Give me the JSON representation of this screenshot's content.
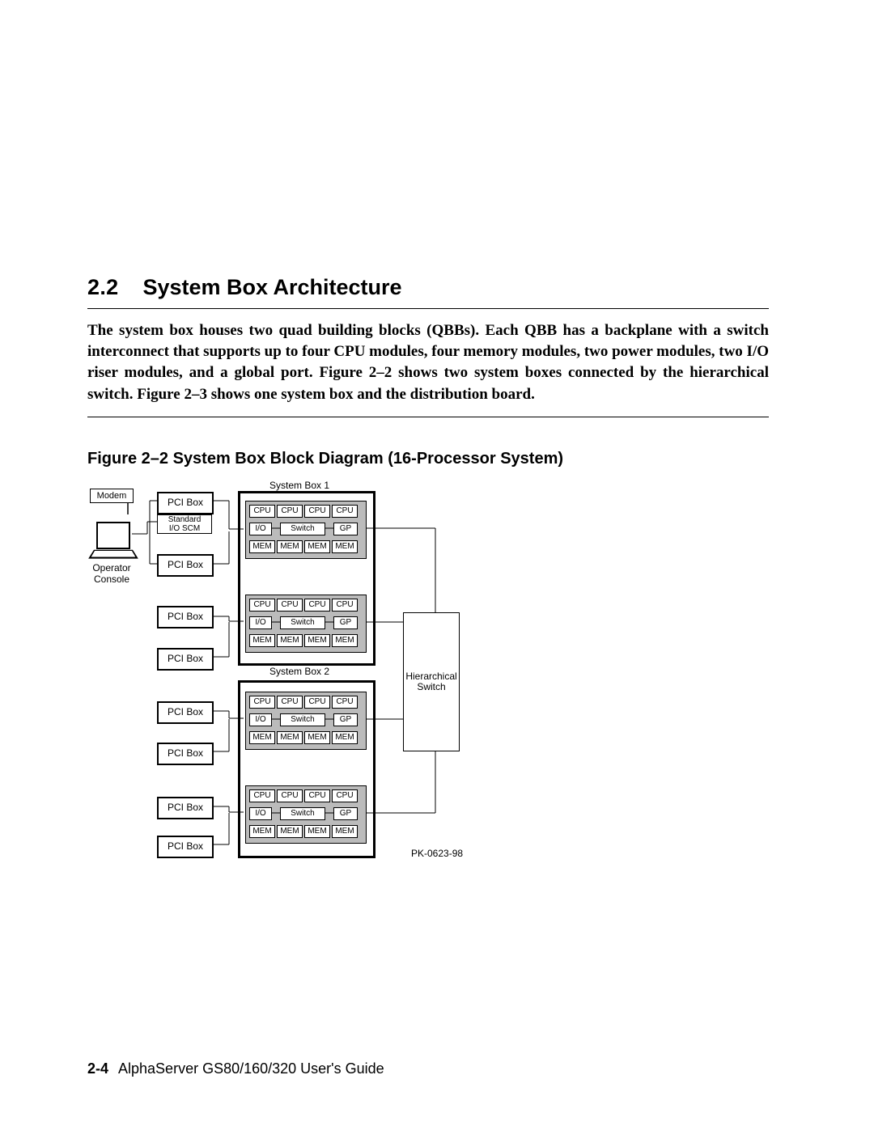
{
  "section_number": "2.2",
  "section_title": "System Box Architecture",
  "abstract": "The system box houses two quad building blocks (QBBs).  Each QBB has a backplane with a switch interconnect that supports up to four CPU modules, four memory modules, two power modules, two I/O riser modules, and a global port. Figure 2–2 shows two system boxes connected by the hierarchical switch. Figure 2–3 shows one system box and the distribution board.",
  "figure_caption": "Figure 2–2   System Box Block Diagram (16-Processor System)",
  "labels": {
    "modem": "Modem",
    "pci_box": "PCI Box",
    "std_io": "Standard\nI/O SCM",
    "op_console": "Operator\nConsole",
    "sysbox1": "System Box 1",
    "sysbox2": "System Box 2",
    "cpu": "CPU",
    "mem": "MEM",
    "switch": "Switch",
    "io": "I/O",
    "gp": "GP",
    "hswitch": "Hierarchical\nSwitch",
    "diag_code": "PK-0623-98"
  },
  "footer_page": "2-4",
  "footer_title": "AlphaServer GS80/160/320 User's Guide"
}
